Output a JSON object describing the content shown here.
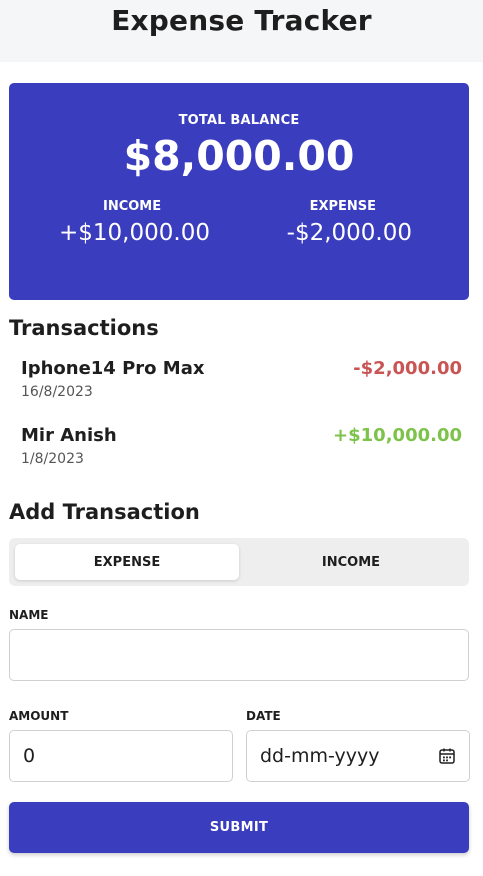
{
  "header": {
    "title": "Expense Tracker"
  },
  "balance": {
    "label": "TOTAL BALANCE",
    "amount": "$8,000.00",
    "income_label": "INCOME",
    "income_value": "+$10,000.00",
    "expense_label": "EXPENSE",
    "expense_value": "-$2,000.00"
  },
  "transactions": {
    "title": "Transactions",
    "items": [
      {
        "name": "Iphone14 Pro Max",
        "date": "16/8/2023",
        "amount": "-$2,000.00",
        "type": "expense"
      },
      {
        "name": "Mir Anish",
        "date": "1/8/2023",
        "amount": "+$10,000.00",
        "type": "income"
      }
    ]
  },
  "add": {
    "title": "Add Transaction",
    "toggle": {
      "expense_label": "EXPENSE",
      "income_label": "INCOME",
      "selected": "EXPENSE"
    },
    "name_label": "NAME",
    "name_value": "",
    "amount_label": "AMOUNT",
    "amount_value": "0",
    "date_label": "DATE",
    "date_placeholder": "dd-mm-yyyy",
    "submit_label": "SUBMIT"
  },
  "colors": {
    "accent": "#3b3dbf",
    "expense": "#c95454",
    "income": "#7dc24a"
  },
  "icons": {
    "date": "calendar-icon"
  }
}
